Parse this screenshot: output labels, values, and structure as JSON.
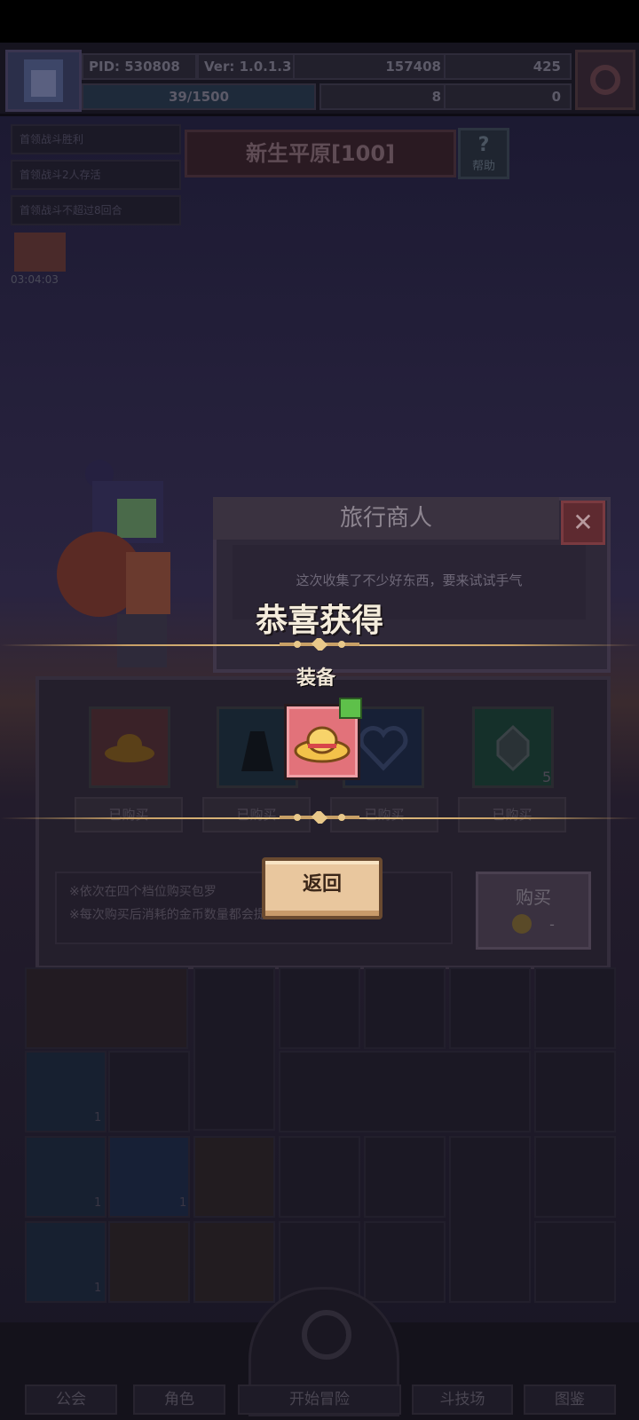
{
  "status_bar": {},
  "topbar": {
    "pid": "PID: 530808",
    "version": "Ver: 1.0.1.3",
    "gold": "157408",
    "gems": "425",
    "exp": "39/1500",
    "clover": "8",
    "keys": "0"
  },
  "quests": [
    "首领战斗胜利",
    "首领战斗2人存活",
    "首领战斗不超过8回合"
  ],
  "stage": {
    "name": "新生平原[100]",
    "help": "帮助"
  },
  "chest_timer": "03:04:03",
  "merchant": {
    "title": "旅行商人",
    "message": "这次收集了不少好东西，要来试试手气"
  },
  "shop": {
    "slots": [
      {
        "label": "已购买",
        "icon": "hat-icon",
        "count": "",
        "color": "#d8646c"
      },
      {
        "label": "已购买",
        "icon": "cloak-icon",
        "count": "",
        "color": "#2e5a7a"
      },
      {
        "label": "已购买",
        "icon": "heart-icon",
        "count": "",
        "color": "#2e4a7a"
      },
      {
        "label": "已购买",
        "icon": "gem-icon",
        "count": "5",
        "color": "#2e6a5a"
      }
    ],
    "info_lines": [
      "※依次在四个档位购买包罗",
      "※每次购买后消耗的金币数量都会提升"
    ],
    "buy_label": "购买",
    "buy_price": "-"
  },
  "reward": {
    "title": "恭喜获得",
    "category": "装备",
    "item_icon": "straw-hat-icon",
    "return_label": "返回"
  },
  "inventory_counts": [
    "1",
    "1",
    "1",
    "1"
  ],
  "nav": {
    "guild": "公会",
    "character": "角色",
    "adventure": "开始冒险",
    "arena": "斗技场",
    "codex": "图鉴"
  }
}
